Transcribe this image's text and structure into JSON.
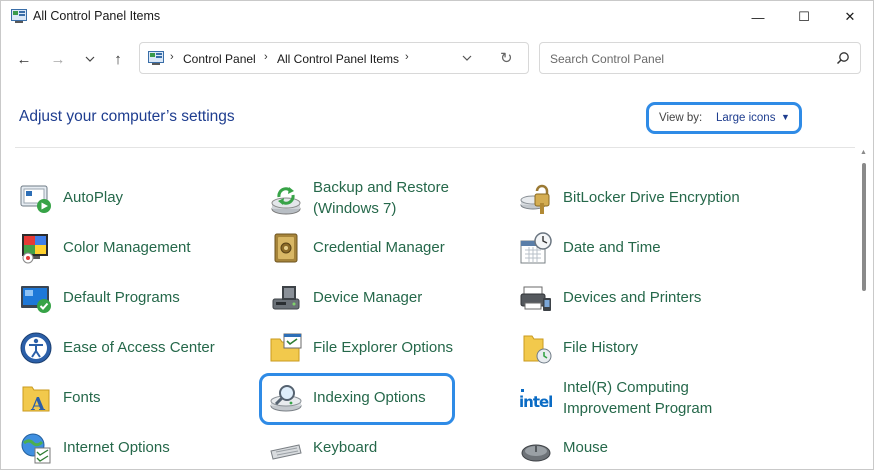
{
  "window": {
    "title": "All Control Panel Items",
    "minimize_glyph": "—",
    "maximize_glyph": "☐",
    "close_glyph": "✕"
  },
  "nav": {
    "back_glyph": "←",
    "forward_glyph": "→",
    "recent_glyph": "⌄",
    "up_glyph": "↑"
  },
  "address": {
    "separator": "›",
    "crumbs": [
      "Control Panel",
      "All Control Panel Items"
    ],
    "dropdown_glyph": "⌄",
    "refresh_glyph": "↻"
  },
  "search": {
    "placeholder": "Search Control Panel"
  },
  "header": {
    "title": "Adjust your computer’s settings",
    "view_by_label": "View by:",
    "view_by_value": "Large icons",
    "view_by_arrow": "▼"
  },
  "accent_colors": {
    "link_green": "#25684a",
    "heading_blue": "#1e3d8f",
    "highlight_blue": "#2f8be6"
  },
  "items": [
    {
      "label": "AutoPlay",
      "icon": "autoplay-icon"
    },
    {
      "label": "Backup and Restore\n(Windows 7)",
      "icon": "backup-restore-icon"
    },
    {
      "label": "BitLocker Drive Encryption",
      "icon": "bitlocker-icon"
    },
    {
      "label": "Color Management",
      "icon": "color-management-icon"
    },
    {
      "label": "Credential Manager",
      "icon": "credential-manager-icon"
    },
    {
      "label": "Date and Time",
      "icon": "date-time-icon"
    },
    {
      "label": "Default Programs",
      "icon": "default-programs-icon"
    },
    {
      "label": "Device Manager",
      "icon": "device-manager-icon"
    },
    {
      "label": "Devices and Printers",
      "icon": "devices-printers-icon"
    },
    {
      "label": "Ease of Access Center",
      "icon": "ease-of-access-icon"
    },
    {
      "label": "File Explorer Options",
      "icon": "file-explorer-options-icon"
    },
    {
      "label": "File History",
      "icon": "file-history-icon"
    },
    {
      "label": "Fonts",
      "icon": "fonts-icon"
    },
    {
      "label": "Indexing Options",
      "icon": "indexing-options-icon"
    },
    {
      "label": "Intel(R) Computing\nImprovement Program",
      "icon": "intel-icon"
    },
    {
      "label": "Internet Options",
      "icon": "internet-options-icon"
    },
    {
      "label": "Keyboard",
      "icon": "keyboard-icon"
    },
    {
      "label": "Mouse",
      "icon": "mouse-icon"
    }
  ]
}
